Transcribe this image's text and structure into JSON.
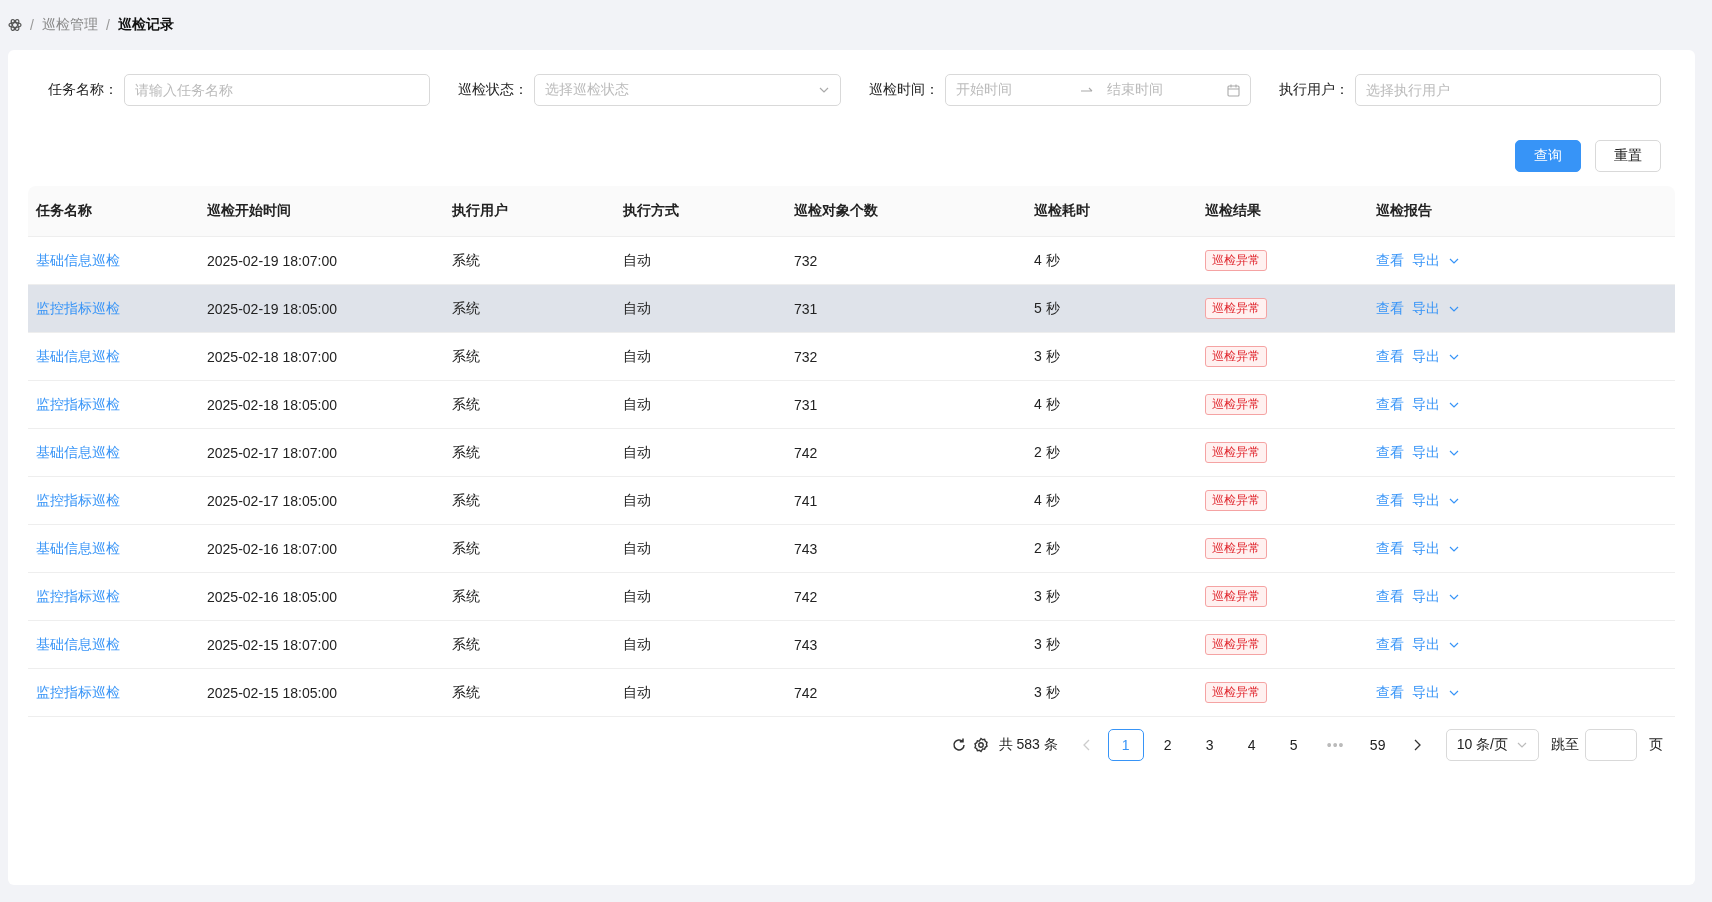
{
  "breadcrumb": [
    {
      "separator": "/",
      "label": "巡检管理",
      "current": false
    },
    {
      "separator": "/",
      "label": "巡检记录",
      "current": true
    }
  ],
  "filters": [
    {
      "kind": "text",
      "label": "任务名称：",
      "placeholder": "请输入任务名称"
    },
    {
      "kind": "select",
      "label": "巡检状态：",
      "placeholder": "选择巡检状态"
    },
    {
      "kind": "daterange",
      "label": "巡检时间：",
      "placeholder": "开始时间",
      "placeholder_end": "结束时间"
    },
    {
      "kind": "text",
      "label": "执行用户：",
      "placeholder": "选择执行用户"
    }
  ],
  "buttons": [
    {
      "label": "查询",
      "primary": true
    },
    {
      "label": "重置",
      "primary": false
    }
  ],
  "table": {
    "columns": [
      "任务名称",
      "巡检开始时间",
      "执行用户",
      "执行方式",
      "巡检对象个数",
      "巡检耗时",
      "巡检结果",
      "巡检报告"
    ],
    "rows": [
      {
        "name": "基础信息巡检",
        "start": "2025-02-19 18:07:00",
        "user": "系统",
        "mode": "自动",
        "count": "732",
        "duration": "4 秒",
        "result": "巡检异常",
        "actions": [
          "查看",
          "导出"
        ],
        "hovered": false
      },
      {
        "name": "监控指标巡检",
        "start": "2025-02-19 18:05:00",
        "user": "系统",
        "mode": "自动",
        "count": "731",
        "duration": "5 秒",
        "result": "巡检异常",
        "actions": [
          "查看",
          "导出"
        ],
        "hovered": true
      },
      {
        "name": "基础信息巡检",
        "start": "2025-02-18 18:07:00",
        "user": "系统",
        "mode": "自动",
        "count": "732",
        "duration": "3 秒",
        "result": "巡检异常",
        "actions": [
          "查看",
          "导出"
        ],
        "hovered": false
      },
      {
        "name": "监控指标巡检",
        "start": "2025-02-18 18:05:00",
        "user": "系统",
        "mode": "自动",
        "count": "731",
        "duration": "4 秒",
        "result": "巡检异常",
        "actions": [
          "查看",
          "导出"
        ],
        "hovered": false
      },
      {
        "name": "基础信息巡检",
        "start": "2025-02-17 18:07:00",
        "user": "系统",
        "mode": "自动",
        "count": "742",
        "duration": "2 秒",
        "result": "巡检异常",
        "actions": [
          "查看",
          "导出"
        ],
        "hovered": false
      },
      {
        "name": "监控指标巡检",
        "start": "2025-02-17 18:05:00",
        "user": "系统",
        "mode": "自动",
        "count": "741",
        "duration": "4 秒",
        "result": "巡检异常",
        "actions": [
          "查看",
          "导出"
        ],
        "hovered": false
      },
      {
        "name": "基础信息巡检",
        "start": "2025-02-16 18:07:00",
        "user": "系统",
        "mode": "自动",
        "count": "743",
        "duration": "2 秒",
        "result": "巡检异常",
        "actions": [
          "查看",
          "导出"
        ],
        "hovered": false
      },
      {
        "name": "监控指标巡检",
        "start": "2025-02-16 18:05:00",
        "user": "系统",
        "mode": "自动",
        "count": "742",
        "duration": "3 秒",
        "result": "巡检异常",
        "actions": [
          "查看",
          "导出"
        ],
        "hovered": false
      },
      {
        "name": "基础信息巡检",
        "start": "2025-02-15 18:07:00",
        "user": "系统",
        "mode": "自动",
        "count": "743",
        "duration": "3 秒",
        "result": "巡检异常",
        "actions": [
          "查看",
          "导出"
        ],
        "hovered": false
      },
      {
        "name": "监控指标巡检",
        "start": "2025-02-15 18:05:00",
        "user": "系统",
        "mode": "自动",
        "count": "742",
        "duration": "3 秒",
        "result": "巡检异常",
        "actions": [
          "查看",
          "导出"
        ],
        "hovered": false
      }
    ]
  },
  "pagination": {
    "total": "共 583 条",
    "pages": [
      {
        "label": "1",
        "selected": true
      },
      {
        "label": "2",
        "selected": false
      },
      {
        "label": "3",
        "selected": false
      },
      {
        "label": "4",
        "selected": false
      },
      {
        "label": "5",
        "selected": false
      },
      {
        "label": "•••",
        "selected": false,
        "kind": "ellipsis"
      },
      {
        "label": "59",
        "selected": false
      }
    ],
    "prev_disabled": true,
    "page_size": "10 条/页",
    "jump_label": "跳至",
    "page_suffix": "页"
  }
}
